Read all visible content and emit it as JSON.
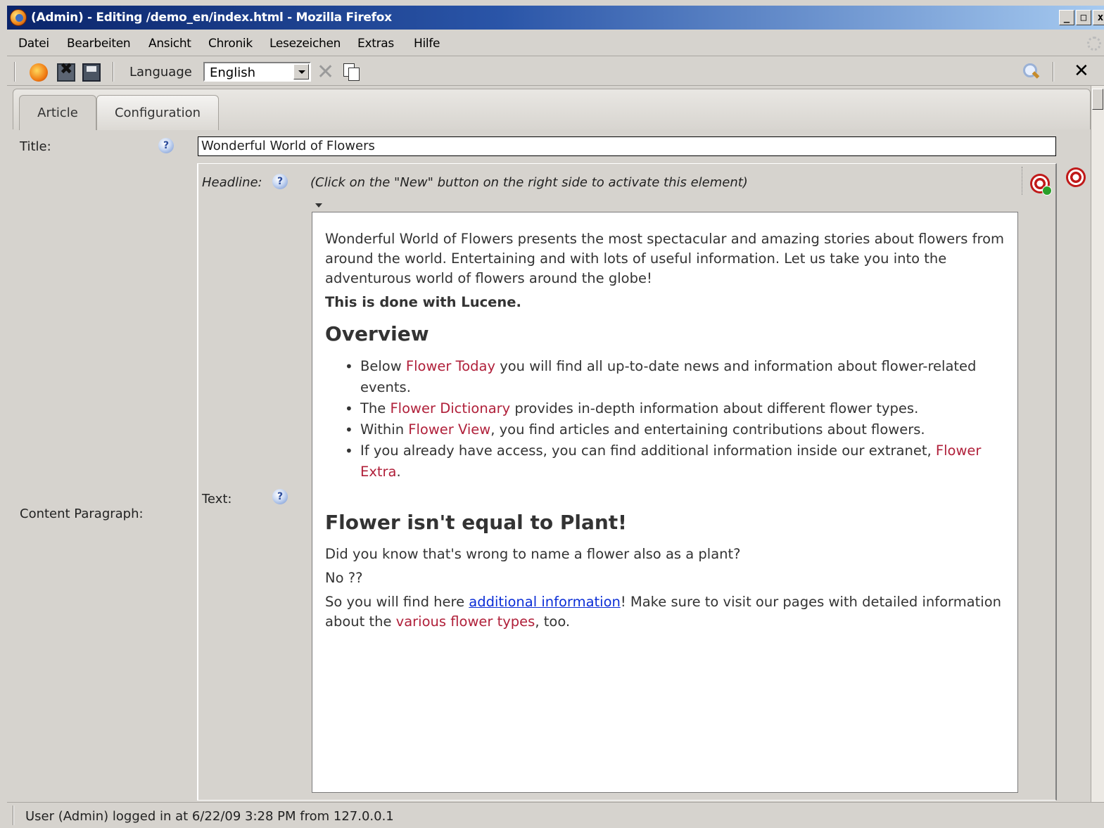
{
  "window": {
    "title": "(Admin) - Editing /demo_en/index.html - Mozilla Firefox",
    "buttons": {
      "minimize": "_",
      "maximize": "□",
      "close": "x"
    }
  },
  "menubar": {
    "items": [
      "Datei",
      "Bearbeiten",
      "Ansicht",
      "Chronik",
      "Lesezeichen",
      "Extras",
      "Hilfe"
    ]
  },
  "toolbar": {
    "icons": [
      "reload-icon",
      "save-close-icon",
      "save-icon",
      "delete-icon",
      "copy-icon",
      "search-icon",
      "close-icon"
    ],
    "language_label": "Language",
    "language_value": "English",
    "close_label": "✕"
  },
  "tabs": [
    {
      "label": "Article",
      "active": true
    },
    {
      "label": "Configuration",
      "active": false
    }
  ],
  "form": {
    "title_label": "Title:",
    "title_value": "Wonderful World of Flowers",
    "help_glyph": "?",
    "content_paragraph_label": "Content Paragraph:",
    "headline_label": "Headline:",
    "headline_hint": "(Click on the \"New\" button on the right side to activate this element)",
    "text_label": "Text:"
  },
  "editor": {
    "intro": "Wonderful World of Flowers presents the most spectacular and amazing stories about flowers from around the world. Entertaining and with lots of useful information. Let us take you into the adventurous world of flowers around the globe!",
    "lucene": "This is done with Lucene.",
    "overview_heading": "Overview",
    "bullets": [
      {
        "pre": "Below ",
        "link": "Flower Today",
        "post": " you will find all up-to-date news and information about flower-related events."
      },
      {
        "pre": "The ",
        "link": "Flower Dictionary",
        "post": " provides in-depth information about different flower types."
      },
      {
        "pre": "Within ",
        "link": "Flower View",
        "post": ", you find articles and entertaining contributions about flowers."
      },
      {
        "pre": "If you already have access, you can find additional information inside our extranet, ",
        "link": "Flower Extra",
        "post": "."
      }
    ],
    "plant_heading": "Flower isn't equal to Plant!",
    "did_you_know": "Did you know that's wrong to name a flower also as a plant?",
    "no_q": "No ??",
    "final_pre": "So you will find here ",
    "final_link": "additional information",
    "final_mid": "! Make sure to visit our pages with detailed information about the ",
    "final_link2": "various flower types",
    "final_post": ", too."
  },
  "status": {
    "text": "User (Admin) logged in at 6/22/09 3:28 PM from 127.0.0.1"
  },
  "colors": {
    "link_red": "#b0203a",
    "link_blue": "#0b2ed6",
    "titlebar_start": "#0a246a"
  }
}
